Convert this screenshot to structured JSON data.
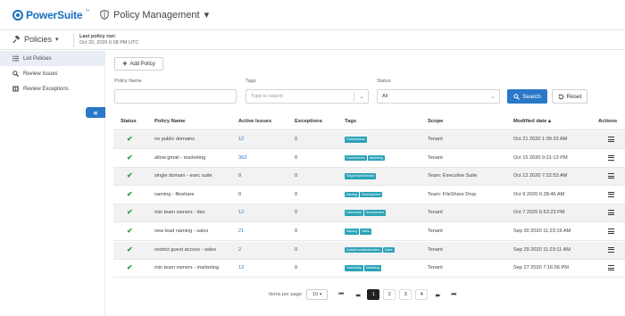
{
  "header": {
    "brand": "PowerSuite",
    "brand_tm": "™",
    "app_title": "Policy Management",
    "app_title_caret": "▾"
  },
  "subheader": {
    "policies_label": "Policies",
    "policies_caret": "▾",
    "last_run_label": "Last policy run:",
    "last_run_value": "Oct 20, 2020 6:08 PM UTC"
  },
  "sidebar": {
    "items": [
      {
        "label": "List Policies",
        "icon": "list-icon",
        "active": true
      },
      {
        "label": "Review Issues",
        "icon": "search-icon",
        "active": false
      },
      {
        "label": "Review Exceptions",
        "icon": "book-icon",
        "active": false
      }
    ],
    "collapse_glyph": "«"
  },
  "toolbar": {
    "add_policy_plus": "+",
    "add_policy_label": "Add Policy"
  },
  "filters": {
    "policy_name_label": "Policy Name",
    "policy_name_value": "",
    "tags_label": "Tags",
    "tags_placeholder": "Type to search",
    "status_label": "Status",
    "status_value": "All",
    "search_label": "Search",
    "reset_label": "Reset"
  },
  "table": {
    "columns": [
      "Status",
      "Policy Name",
      "Active Issues",
      "Exceptions",
      "Tags",
      "Scope",
      "Modified date ▴",
      "Actions"
    ],
    "rows": [
      {
        "status": "✔",
        "name": "no public domains",
        "issues": "12",
        "issues_link": true,
        "exceptions": "0",
        "tags": [
          "GuestAccess"
        ],
        "scope": "Tenant",
        "modified": "Oct 21 2020 1:09:33 AM"
      },
      {
        "status": "✔",
        "name": "allow gmail - marketing",
        "issues": "363",
        "issues_link": true,
        "exceptions": "0",
        "tags": [
          "GuestAccess",
          "Marketing"
        ],
        "scope": "Tenant",
        "modified": "Oct 15 2020 9:21:13 PM"
      },
      {
        "status": "✔",
        "name": "single domain - exec suite",
        "issues": "0",
        "issues_link": false,
        "exceptions": "0",
        "tags": [
          "SingleGuestDomain"
        ],
        "scope": "Team: Executive Suite",
        "modified": "Oct 12 2020 7:22:53 AM"
      },
      {
        "status": "✔",
        "name": "naming - fileshare",
        "issues": "0",
        "issues_link": false,
        "exceptions": "0",
        "tags": [
          "Naming",
          "Development"
        ],
        "scope": "Team: FileShare Drop",
        "modified": "Oct 9 2020 6:28:46 AM"
      },
      {
        "status": "✔",
        "name": "min team owners - dev",
        "issues": "12",
        "issues_link": true,
        "exceptions": "0",
        "tags": [
          "Ownership",
          "Development"
        ],
        "scope": "Tenant",
        "modified": "Oct 7 2020 6:53:23 PM"
      },
      {
        "status": "✔",
        "name": "new lead naming - sales",
        "issues": "21",
        "issues_link": true,
        "exceptions": "0",
        "tags": [
          "Naming",
          "Sales"
        ],
        "scope": "Tenant",
        "modified": "Sep 30 2020 11:23:16 AM"
      },
      {
        "status": "✔",
        "name": "restrict guest access - sales",
        "issues": "2",
        "issues_link": true,
        "exceptions": "0",
        "tags": [
          "GuestDomainInteraction",
          "Sales"
        ],
        "scope": "Tenant",
        "modified": "Sep 29 2020 11:23:11 AM"
      },
      {
        "status": "✔",
        "name": "min team owners - marketing",
        "issues": "12",
        "issues_link": true,
        "exceptions": "0",
        "tags": [
          "Ownership",
          "Marketing"
        ],
        "scope": "Tenant",
        "modified": "Sep 27 2020 7:16:56 PM"
      }
    ]
  },
  "pagination": {
    "items_per_page_label": "Items per page:",
    "items_per_page_value": "10",
    "first": "⏮",
    "prev": "◀◀",
    "pages": [
      "1",
      "2",
      "3",
      "4"
    ],
    "active_page": "1",
    "next": "▶▶",
    "last": "⏭"
  },
  "colors": {
    "brand": "#1a6fc2",
    "accent": "#2a78c8",
    "check": "#2e9c4b",
    "tag": "#2aa3b8"
  }
}
